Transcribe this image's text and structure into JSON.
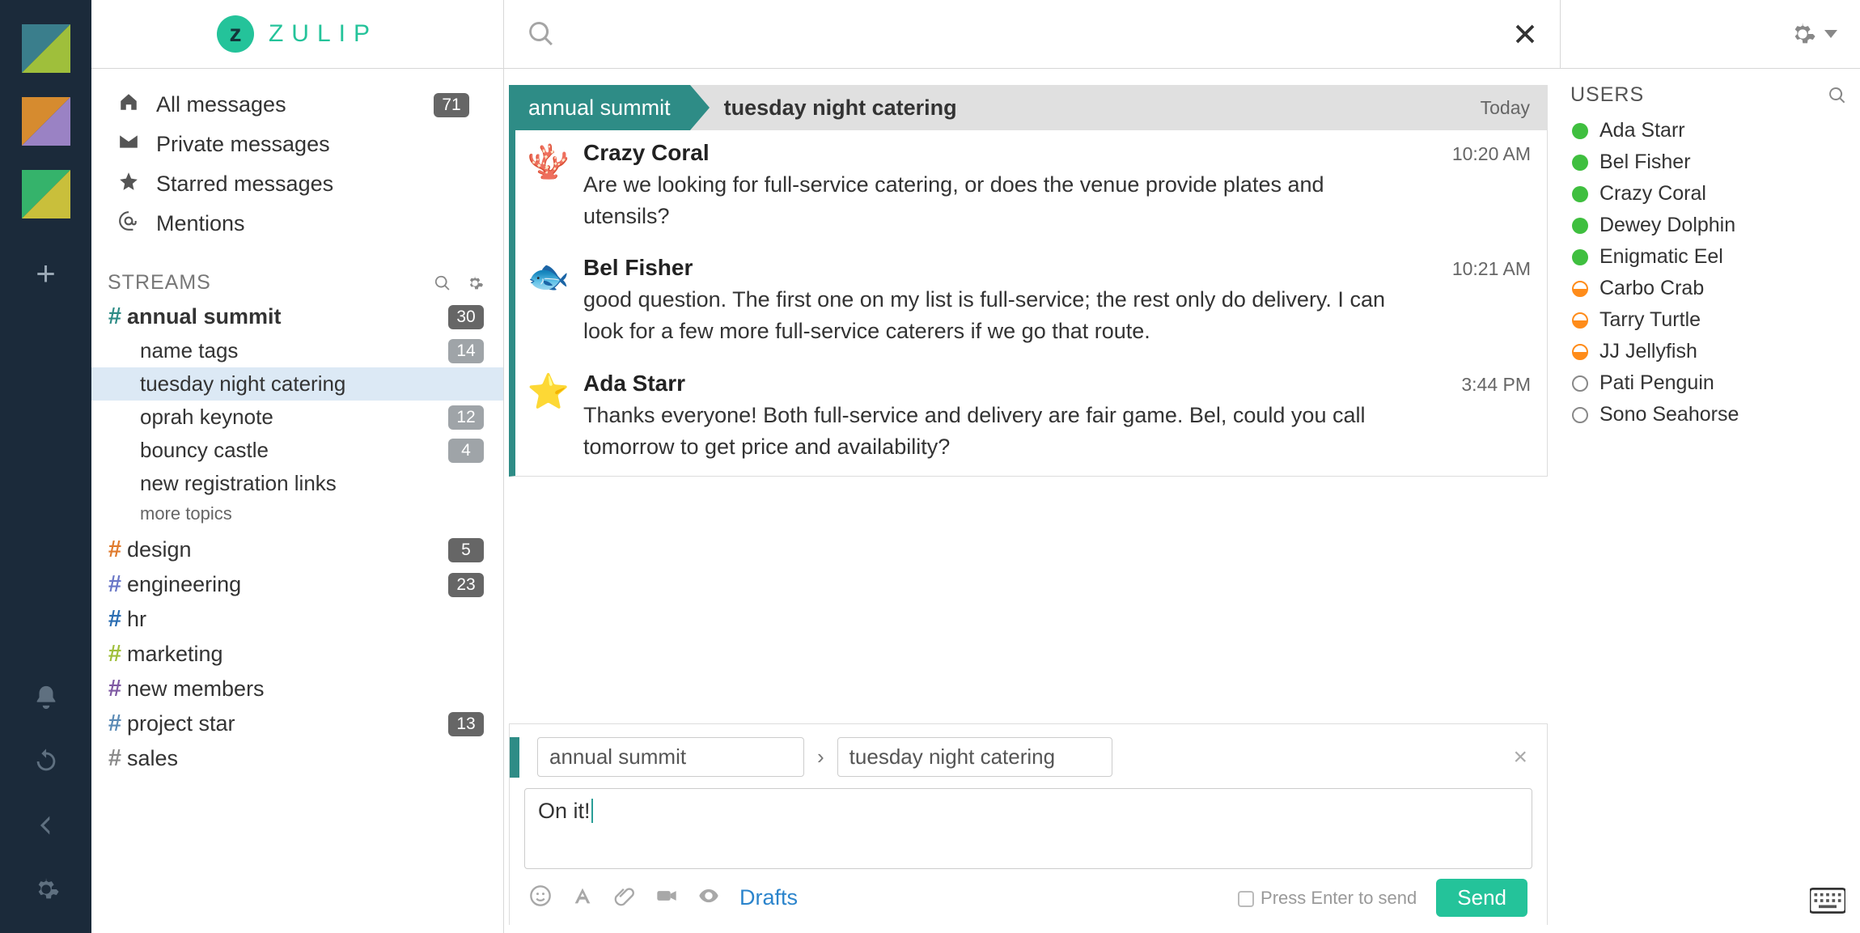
{
  "brand": {
    "name": "ZULIP"
  },
  "nav": {
    "all_messages": "All messages",
    "all_messages_badge": "71",
    "private": "Private messages",
    "starred": "Starred messages",
    "mentions": "Mentions"
  },
  "streams_header": "STREAMS",
  "streams": [
    {
      "name": "annual summit",
      "color": "#2e8c86",
      "badge": "30",
      "active": true,
      "topics": [
        {
          "name": "name tags",
          "badge": "14"
        },
        {
          "name": "tuesday night catering",
          "selected": true
        },
        {
          "name": "oprah keynote",
          "badge": "12"
        },
        {
          "name": "bouncy castle",
          "badge": "4"
        },
        {
          "name": "new registration links"
        }
      ],
      "more_topics": "more topics"
    },
    {
      "name": "design",
      "color": "#e07b2e",
      "badge": "5"
    },
    {
      "name": "engineering",
      "color": "#6a77c7",
      "badge": "23"
    },
    {
      "name": "hr",
      "color": "#2a6db2"
    },
    {
      "name": "marketing",
      "color": "#9fbf3b"
    },
    {
      "name": "new members",
      "color": "#7f5aa3"
    },
    {
      "name": "project star",
      "color": "#5a8ab5",
      "badge": "13"
    },
    {
      "name": "sales",
      "color": "#8a8a8a"
    }
  ],
  "thread": {
    "stream": "annual summit",
    "topic": "tuesday night catering",
    "date": "Today",
    "messages": [
      {
        "avatar_glyph": "🪸",
        "avatar_color": "#b056c9",
        "name": "Crazy Coral",
        "time": "10:20 AM",
        "text": "Are we looking for full-service catering, or does the venue provide plates and utensils?"
      },
      {
        "avatar_glyph": "🐟",
        "avatar_color": "#8fcf3f",
        "name": "Bel Fisher",
        "time": "10:21 AM",
        "text": "good question. The first one on my list is full-service; the rest only do delivery. I can look for a few more full-service caterers if we go that route."
      },
      {
        "avatar_glyph": "⭐",
        "avatar_color": "#c97a52",
        "name": "Ada Starr",
        "time": "3:44 PM",
        "text": "Thanks everyone! Both full-service and delivery are fair game. Bel, could you call tomorrow to get price and availability?"
      }
    ]
  },
  "compose": {
    "stream": "annual summit",
    "topic": "tuesday night catering",
    "text": "On it!",
    "drafts": "Drafts",
    "press_enter": "Press Enter to send",
    "send": "Send"
  },
  "users_header": "USERS",
  "users": [
    {
      "name": "Ada Starr",
      "status": "online"
    },
    {
      "name": "Bel Fisher",
      "status": "online"
    },
    {
      "name": "Crazy Coral",
      "status": "online"
    },
    {
      "name": "Dewey Dolphin",
      "status": "online"
    },
    {
      "name": "Enigmatic Eel",
      "status": "online"
    },
    {
      "name": "Carbo Crab",
      "status": "idle"
    },
    {
      "name": "Tarry Turtle",
      "status": "idle"
    },
    {
      "name": "JJ Jellyfish",
      "status": "idle"
    },
    {
      "name": "Pati Penguin",
      "status": "offline"
    },
    {
      "name": "Sono Seahorse",
      "status": "offline"
    }
  ]
}
